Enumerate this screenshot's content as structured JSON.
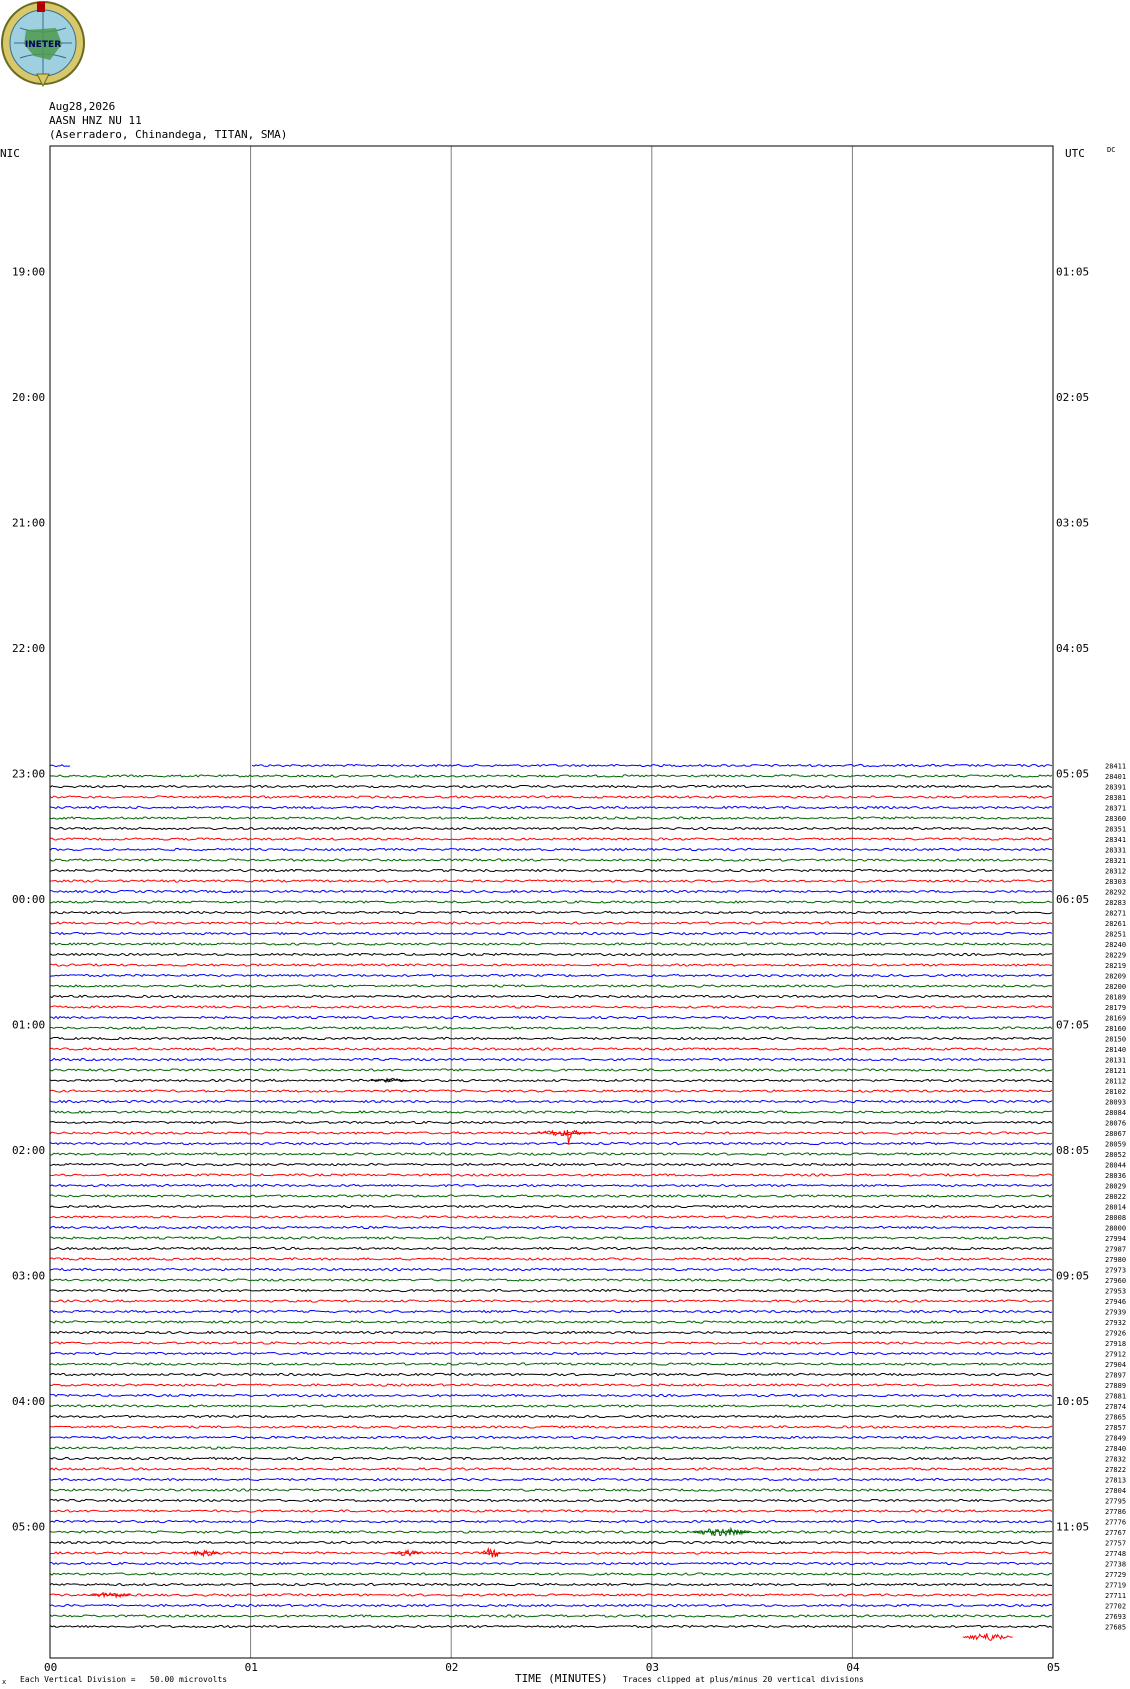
{
  "logo": {
    "text": "INETER"
  },
  "header": {
    "date": "Aug28,2026",
    "station": "AASN HNZ NU 11",
    "location": "(Aserradero, Chinandega, TITAN, SMA)"
  },
  "labels": {
    "left_zone": "NIC",
    "right_zone": "UTC",
    "dc": "DC",
    "xlabel": "TIME (MINUTES)",
    "scale_note": "Each Vertical Division =   50.00 microvolts",
    "clip_note": "Traces clipped at plus/minus 20 vertical divisions",
    "corner_mark": "x"
  },
  "colors": {
    "trace_cycle": [
      "#0000ff",
      "#006400",
      "#000000",
      "#ff0000"
    ],
    "grid": "#808080",
    "frame": "#000000"
  },
  "chart_data": {
    "type": "line",
    "title": "AASN HNZ NU 11",
    "xlabel": "TIME (MINUTES)",
    "xlim": [
      0,
      5
    ],
    "x_ticks": [
      "00",
      "01",
      "02",
      "03",
      "04",
      "05"
    ],
    "hour_rows": 12,
    "traces_per_hour": 12,
    "left_hour_labels": [
      "19:00",
      "20:00",
      "21:00",
      "22:00",
      "23:00",
      "00:00",
      "01:00",
      "02:00",
      "03:00",
      "04:00",
      "05:00"
    ],
    "right_hour_labels": [
      "01:05",
      "02:05",
      "03:05",
      "04:05",
      "05:05",
      "06:05",
      "07:05",
      "08:05",
      "09:05",
      "10:05",
      "11:05"
    ],
    "first_trace_row": 59,
    "gap_in_first_trace": [
      0.1,
      1.0
    ],
    "trace_counts": [
      "28411",
      "28401",
      "28391",
      "28381",
      "28371",
      "28360",
      "28351",
      "28341",
      "28331",
      "28321",
      "28312",
      "28303",
      "28292",
      "28283",
      "28271",
      "28261",
      "28251",
      "28240",
      "28229",
      "28219",
      "28209",
      "28200",
      "28189",
      "28179",
      "28169",
      "28160",
      "28150",
      "28140",
      "28131",
      "28121",
      "28112",
      "28102",
      "28093",
      "28084",
      "28076",
      "28067",
      "28059",
      "28052",
      "28044",
      "28036",
      "28029",
      "28022",
      "28014",
      "28008",
      "28000",
      "27994",
      "27987",
      "27980",
      "27973",
      "27960",
      "27953",
      "27946",
      "27939",
      "27932",
      "27926",
      "27918",
      "27912",
      "27904",
      "27897",
      "27889",
      "27881",
      "27874",
      "27865",
      "27857",
      "27849",
      "27840",
      "27832",
      "27822",
      "27813",
      "27804",
      "27795",
      "27786",
      "27776",
      "27767",
      "27757",
      "27748",
      "27738",
      "27729",
      "27719",
      "27711",
      "27702",
      "27693",
      "27685"
    ],
    "events": [
      {
        "trace": 30,
        "start": 1.6,
        "end": 1.8,
        "amplitude": 2
      },
      {
        "trace": 35,
        "start": 2.4,
        "end": 2.7,
        "amplitude": 3
      },
      {
        "trace": 35,
        "start": 2.57,
        "end": 2.6,
        "amplitude": 16
      },
      {
        "trace": 73,
        "start": 3.2,
        "end": 3.5,
        "amplitude": 4
      },
      {
        "trace": 75,
        "start": 0.7,
        "end": 0.85,
        "amplitude": 3
      },
      {
        "trace": 75,
        "start": 1.7,
        "end": 1.85,
        "amplitude": 3
      },
      {
        "trace": 75,
        "start": 2.15,
        "end": 2.25,
        "amplitude": 5
      },
      {
        "trace": 79,
        "start": 0.2,
        "end": 0.4,
        "amplitude": 3
      },
      {
        "trace": 83,
        "start": 4.55,
        "end": 4.8,
        "amplitude": 4
      }
    ]
  }
}
